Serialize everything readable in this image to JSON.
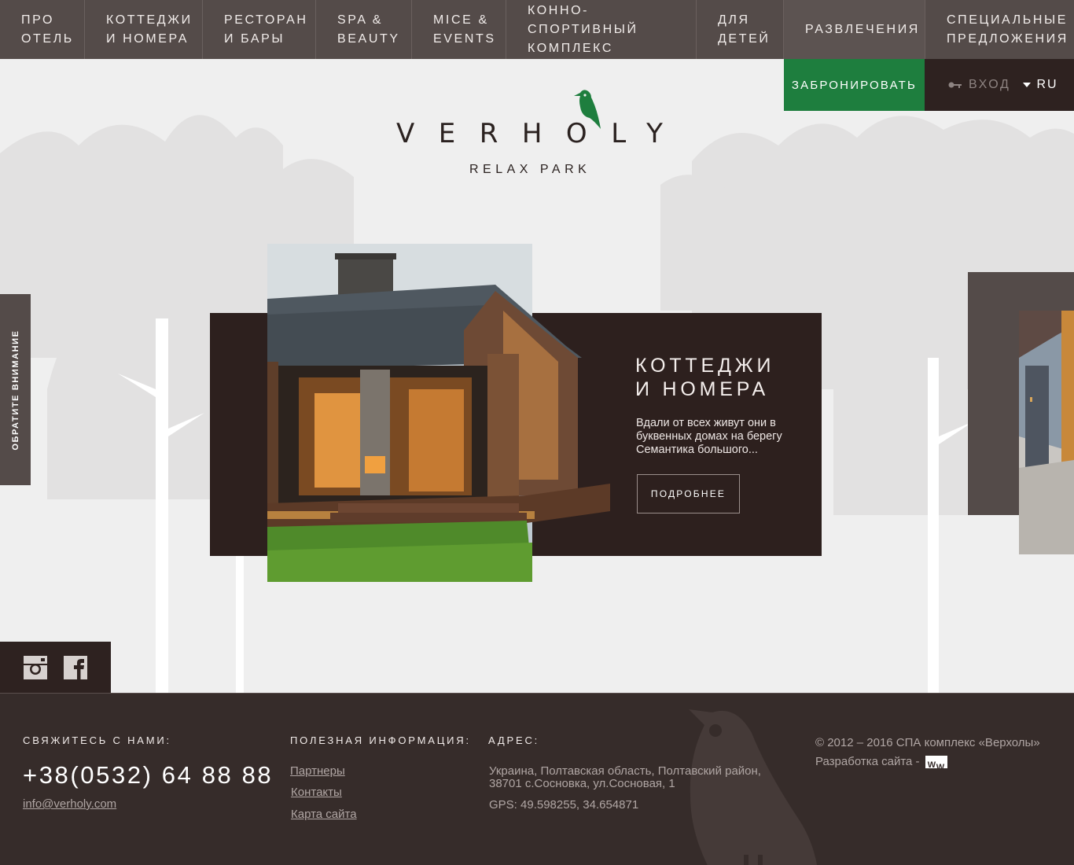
{
  "nav": {
    "items": [
      {
        "label": "Про\nотель"
      },
      {
        "label": "Коттеджи\nи номера"
      },
      {
        "label": "Ресторан\nи бары"
      },
      {
        "label": "SPA &\nBeauty"
      },
      {
        "label": "MICE &\nEvents"
      },
      {
        "label": "Конно-спортивный\nкомплекс"
      },
      {
        "label": "Для\nдетей"
      },
      {
        "label": "Развлечения"
      },
      {
        "label": "Специальные\nпредложения"
      }
    ]
  },
  "header": {
    "book_label": "ЗАБРОНИРОВАТЬ",
    "login_label": "ВХОД",
    "lang_label": "RU",
    "login_icon": "key-icon",
    "lang_icon": "triangle-down-icon"
  },
  "logo": {
    "word": "VERHOLY",
    "sub": "RELAX PARK"
  },
  "side_tab": {
    "label": "ОБРАТИТЕ ВНИМАНИЕ"
  },
  "slide": {
    "title": "КОТТЕДЖИ\nИ НОМЕРА",
    "text": "Вдали от всех живут они в буквенных домах на берегу Семантика большого...",
    "button": "ПОДРОБНЕЕ"
  },
  "social": {
    "icons": [
      "instagram-icon",
      "facebook-icon"
    ]
  },
  "footer": {
    "contact_head": "СВЯЖИТЕСЬ С НАМИ:",
    "phone": "+38(0532) 64 88 88",
    "email": "info@verholy.com",
    "info_head": "ПОЛЕЗНАЯ ИНФОРМАЦИЯ:",
    "links": [
      "Партнеры",
      "Контакты",
      "Карта сайта"
    ],
    "address_head": "АДРЕС:",
    "address": "Украина, Полтавская область, Полтавский район, 38701 с.Сосновка, ул.Сосновая, 1",
    "gps": "GPS: 49.598255, 34.654871",
    "copyright": "© 2012 – 2016  СПА комплекс «Верхолы»",
    "dev": "Разработка сайта -",
    "dev_logo": "ww"
  },
  "colors": {
    "nav_bg": "#544b49",
    "book_green": "#1e7e3e",
    "dark_brown": "#2d201e",
    "footer_bg": "#362c2a",
    "bird_green": "#1e7e3e"
  }
}
